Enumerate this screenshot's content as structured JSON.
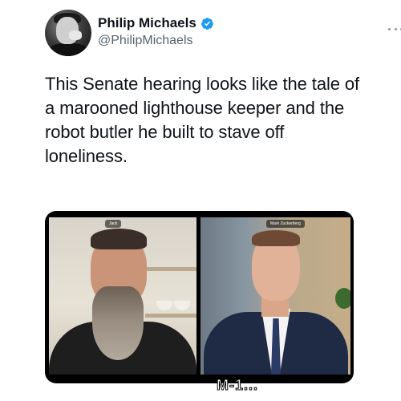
{
  "tweet": {
    "author": {
      "display_name": "Philip Michaels",
      "handle": "@PhilipMichaels",
      "verified": true,
      "verified_icon": "verified-badge-icon",
      "verified_color": "#1d9bf0"
    },
    "more_icon": "more-options-icon",
    "text": "This Senate hearing looks like the tale of a marooned lighthouse keeper and the robot butler he built to stave off loneliness."
  },
  "media": {
    "type": "video-call-screenshot",
    "panels": [
      {
        "label": "Jack"
      },
      {
        "label": "Mark Zuckerberg"
      }
    ],
    "caption_fragment": "M-1..."
  }
}
